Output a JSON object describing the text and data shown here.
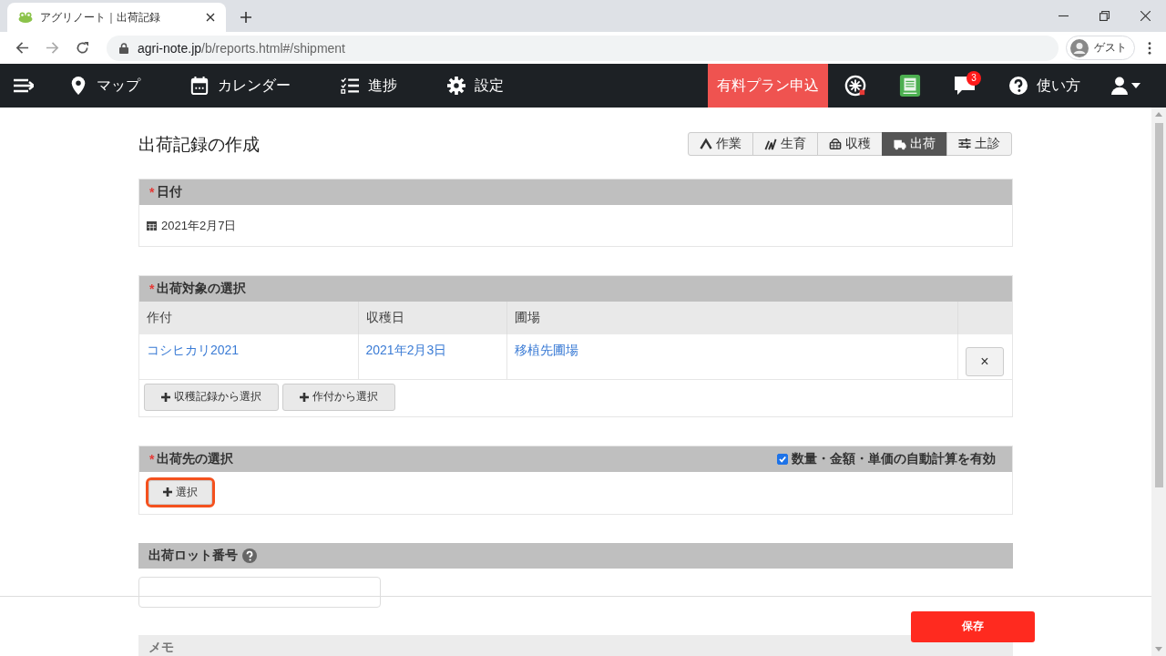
{
  "browser": {
    "tab_title": "アグリノート｜出荷記録",
    "url_host": "agri-note.jp",
    "url_path": "/b/reports.html#/shipment",
    "profile": "ゲスト"
  },
  "nav": {
    "items": [
      {
        "kind": "map",
        "label": "マップ"
      },
      {
        "kind": "calendar",
        "label": "カレンダー"
      },
      {
        "kind": "progress",
        "label": "進捗"
      },
      {
        "kind": "settings",
        "label": "設定"
      }
    ],
    "plan_button": "有料プラン申込",
    "notification_count": "3",
    "help": "使い方"
  },
  "page_title": "出荷記録の作成",
  "record_tabs": [
    {
      "kind": "work",
      "label": "作業",
      "selected": false
    },
    {
      "kind": "growth",
      "label": "生育",
      "selected": false
    },
    {
      "kind": "harvest",
      "label": "収穫",
      "selected": false
    },
    {
      "kind": "shipment",
      "label": "出荷",
      "selected": true
    },
    {
      "kind": "soil",
      "label": "土診",
      "selected": false
    }
  ],
  "date_section": {
    "title": "日付",
    "required_mark": "*",
    "date": "2021年2月7日"
  },
  "target_section": {
    "title": "出荷対象の選択",
    "required_mark": "*",
    "columns": [
      "作付",
      "収穫日",
      "圃場"
    ],
    "rows": [
      {
        "cells": [
          "コシヒカリ2021",
          "2021年2月3日",
          "移植先圃場"
        ],
        "remove": "×"
      }
    ],
    "buttons": [
      "収穫記録から選択",
      "作付から選択"
    ]
  },
  "destination_section": {
    "title": "出荷先の選択",
    "required_mark": "*",
    "auto_calc": {
      "label": "数量・金額・単価の自動計算を有効",
      "checked": true
    },
    "select_button": {
      "label": "選択",
      "highlighted": true
    }
  },
  "lot_section": {
    "title": "出荷ロット番号"
  },
  "memo_section": {
    "title": "メモ"
  },
  "save_button": "保存"
}
